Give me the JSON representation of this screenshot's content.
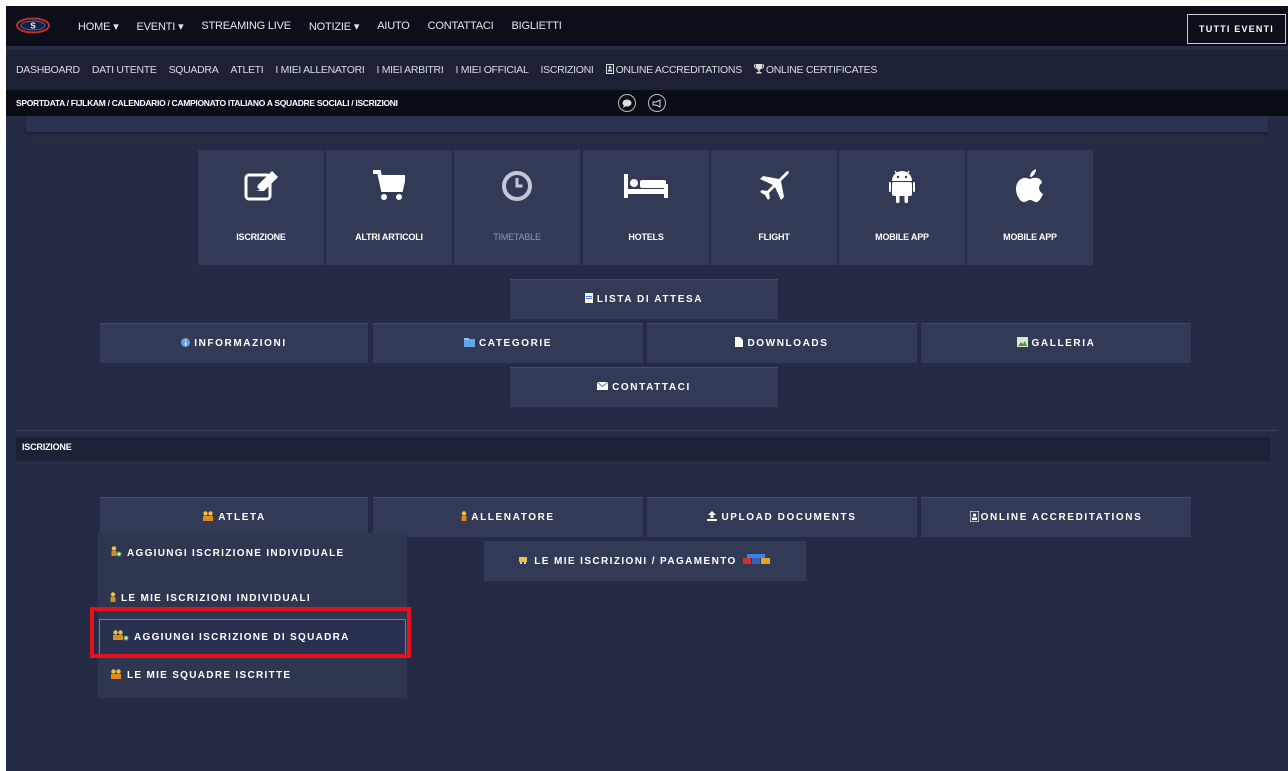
{
  "topnav": {
    "items": [
      {
        "label": "HOME",
        "dropdown": true
      },
      {
        "label": "EVENTI",
        "dropdown": true
      },
      {
        "label": "STREAMING LIVE",
        "dropdown": false
      },
      {
        "label": "NOTIZIE",
        "dropdown": true
      },
      {
        "label": "AIUTO",
        "dropdown": false
      },
      {
        "label": "CONTATTACI",
        "dropdown": false
      },
      {
        "label": "BIGLIETTI",
        "dropdown": false
      }
    ],
    "caret": "▾",
    "tutti_eventi": "TUTTI EVENTI"
  },
  "subnav": {
    "items": [
      "DASHBOARD",
      "DATI UTENTE",
      "SQUADRA",
      "ATLETI",
      "I MIEI ALLENATORI",
      "I MIEI ARBITRI",
      "I MIEI OFFICIAL",
      "ISCRIZIONI",
      "ONLINE ACCREDITATIONS",
      "ONLINE CERTIFICATES"
    ]
  },
  "breadcrumb": "SPORTDATA / FIJLKAM / CALENDARIO / CAMPIONATO ITALIANO A SQUADRE SOCIALI / ISCRIZIONI",
  "tiles": [
    {
      "label": "ISCRIZIONE",
      "icon": "edit-icon",
      "enabled": true
    },
    {
      "label": "ALTRI ARTICOLI",
      "icon": "cart-icon",
      "enabled": true
    },
    {
      "label": "TIMETABLE",
      "icon": "clock-icon",
      "enabled": false
    },
    {
      "label": "HOTELS",
      "icon": "bed-icon",
      "enabled": true
    },
    {
      "label": "FLIGHT",
      "icon": "plane-icon",
      "enabled": true
    },
    {
      "label": "MOBILE APP",
      "icon": "android-icon",
      "enabled": true
    },
    {
      "label": "MOBILE APP",
      "icon": "apple-icon",
      "enabled": true
    }
  ],
  "buttons": {
    "lista_attesa": "LISTA DI ATTESA",
    "informazioni": "INFORMAZIONI",
    "categorie": "CATEGORIE",
    "downloads": "DOWNLOADS",
    "galleria": "GALLERIA",
    "contattaci": "CONTATTACI"
  },
  "section_title": "ISCRIZIONE",
  "reg_tabs": {
    "atleta": "ATLETA",
    "allenatore": "ALLENATORE",
    "upload": "UPLOAD DOCUMENTS",
    "accreditations": "ONLINE ACCREDITATIONS"
  },
  "atleta_menu": [
    {
      "label": "AGGIUNGI ISCRIZIONE INDIVIDUALE",
      "icon": "person-add-icon"
    },
    {
      "label": "LE MIE ISCRIZIONI INDIVIDUALI",
      "icon": "person-icon"
    },
    {
      "label": "AGGIUNGI ISCRIZIONE DI SQUADRA",
      "icon": "group-add-icon",
      "highlighted": true
    },
    {
      "label": "LE MIE SQUADRE ISCRITTE",
      "icon": "group-icon"
    }
  ],
  "payment_button": "LE MIE ISCRIZIONI / PAGAMENTO",
  "colors": {
    "background": "#252b45",
    "tile": "#333a55",
    "topbar": "#0c0f1a",
    "highlight": "#e8101a"
  }
}
